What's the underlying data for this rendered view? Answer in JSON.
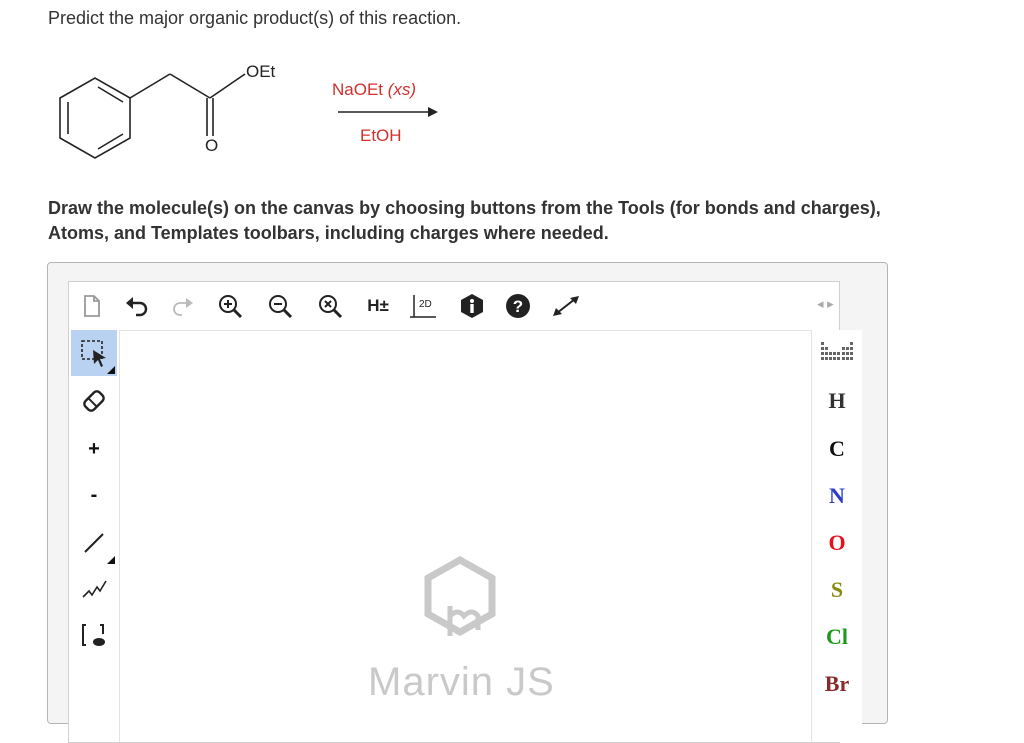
{
  "question": "Predict the major organic product(s) of this reaction.",
  "reaction": {
    "group_label": "OEt",
    "carbonyl_label": "O",
    "reagent": "NaOEt",
    "reagent_note": "(xs)",
    "solvent": "EtOH",
    "reagent_color": "#d0312d"
  },
  "instructions_line1": "Draw the molecule(s) on the canvas by choosing buttons from the Tools (for bonds and charges),",
  "instructions_line2": "Atoms, and Templates toolbars, including charges where needed.",
  "editor": {
    "top_toolbar": [
      "new-document-icon",
      "undo-icon",
      "redo-icon",
      "zoom-in-icon",
      "zoom-out-icon",
      "zoom-reset-icon",
      "hydrogens-icon",
      "clean-2d-icon",
      "info-icon",
      "help-icon",
      "fullscreen-icon"
    ],
    "hydrogens_label": "H±",
    "clean_label": "2D",
    "left_tools": {
      "plus": "+",
      "minus": "-"
    },
    "atoms": [
      {
        "symbol": "H",
        "color": "#333333"
      },
      {
        "symbol": "C",
        "color": "#111111"
      },
      {
        "symbol": "N",
        "color": "#2b3ec9"
      },
      {
        "symbol": "O",
        "color": "#e8101d"
      },
      {
        "symbol": "S",
        "color": "#8a8a10"
      },
      {
        "symbol": "Cl",
        "color": "#1b9a1b"
      },
      {
        "symbol": "Br",
        "color": "#8a2a2a"
      }
    ],
    "watermark": "Marvin JS"
  }
}
